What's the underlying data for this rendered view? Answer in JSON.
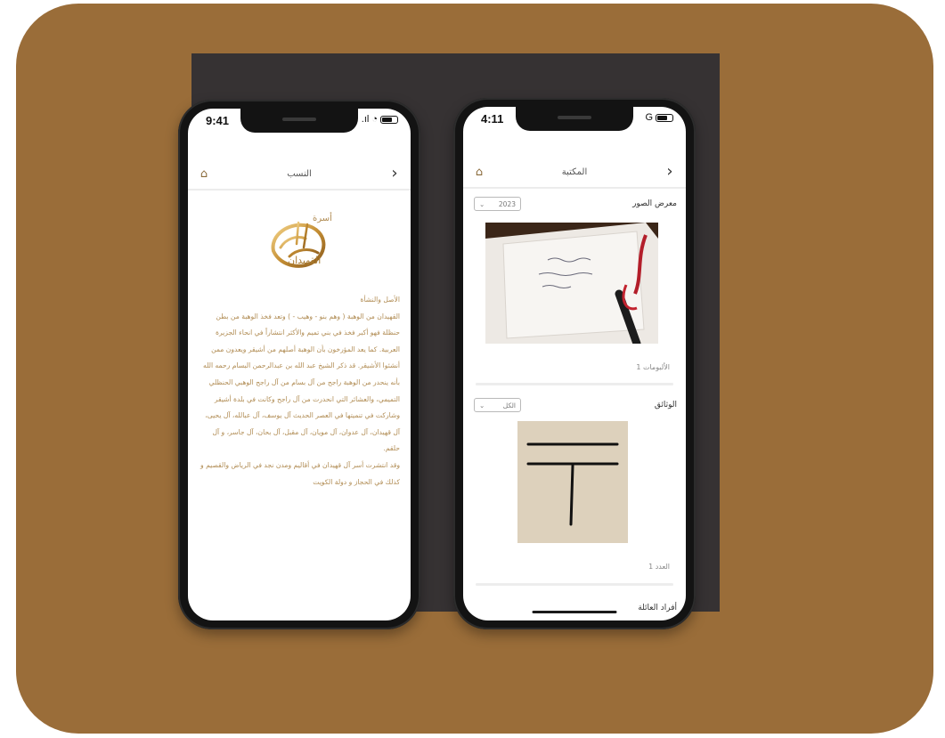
{
  "phone_left": {
    "status": {
      "time": "9:41"
    },
    "nav": {
      "title": "النسب",
      "home_icon": "home-icon",
      "back_icon": "chevron-right-icon"
    },
    "logo_text": {
      "top": "أسرة",
      "main": "القهيدان"
    },
    "article": {
      "heading": "الأصل والنشأة",
      "paragraphs": [
        "القهيدان من الوهبة ( وهم بنو - وهيب - ) وتعد فخذ الوهبة من بطن حنظلة فهو أكبر فخذ في بني تميم والأكثر انتشاراً في انحاء الجزيرة العربية. كما يعد المؤرخون بأن الوهبة أصلهم من أشيقر ويعدون ممن أنشئوا الأشيقر. قد ذكر الشيخ عبد الله بن عبدالرحمن البسام رحمه الله بأنه ينحدر من الوهبة راجح من آل بسام من آل راجح الوهبي الحنظلي التميمي، والعشائر التي انحدرت من آل راجح وكانت في بلدة أشيقر وشاركت في تنميتها في العصر الحديث آل يوسف، آل عبالله، آل يحيى، آل قهيدان، آل عدوان، آل مويان، آل مقبل، آل بحان، آل جاسر، و آل حلقم.",
        "وقد انتشرت أسر آل قهيدان في أقاليم ومدن نجد في الرياض والقصيم و كذلك في الحجاز و دولة الكويت"
      ]
    }
  },
  "phone_right": {
    "status": {
      "time": "4:11",
      "network": "G"
    },
    "nav": {
      "title": "المكتبة",
      "home_icon": "home-icon",
      "back_icon": "chevron-right-icon"
    },
    "photo_gallery": {
      "title": "معرض الصور",
      "dropdown_value": "2023",
      "caption": "الألبومات 1"
    },
    "documents": {
      "title": "الوثائق",
      "dropdown_value": "الكل",
      "caption": "العدد 1"
    },
    "family_members": {
      "title": "أفراد العائلة"
    }
  },
  "colors": {
    "background": "#9a6d39",
    "accent": "#b08b52",
    "frame": "#131313"
  }
}
